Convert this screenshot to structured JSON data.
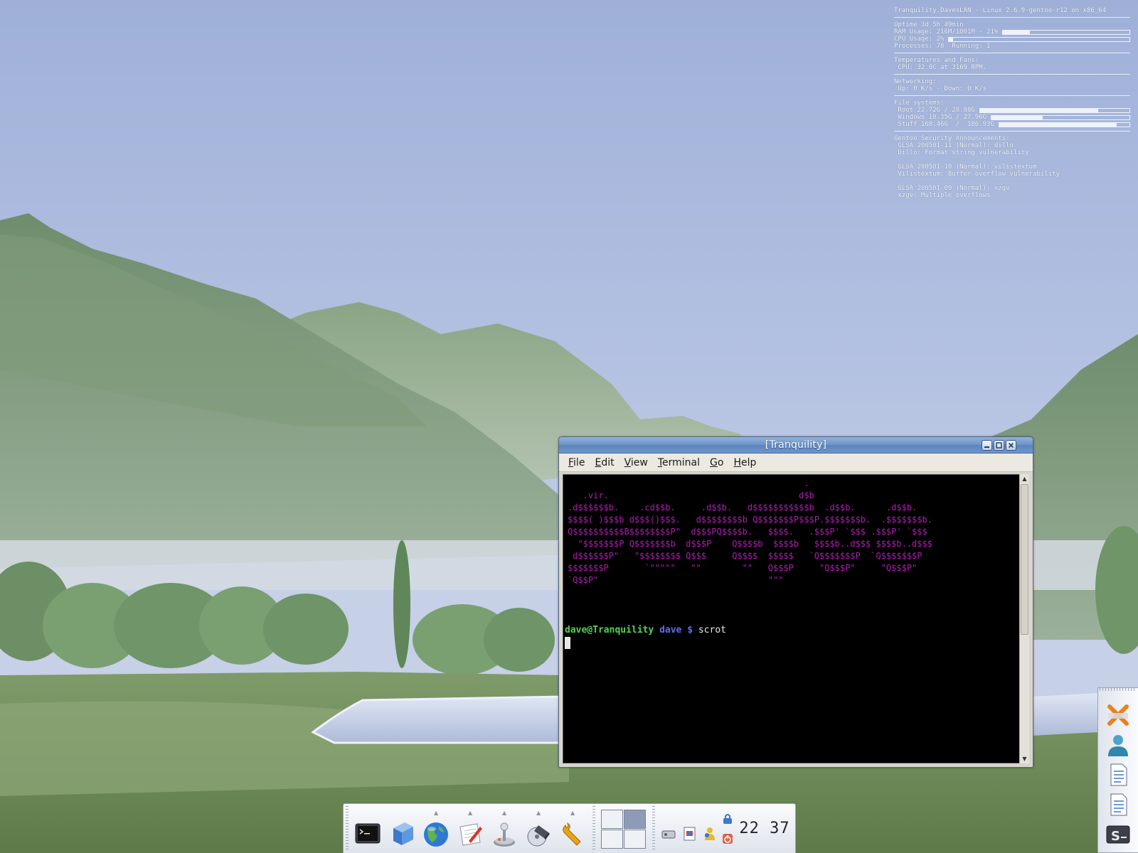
{
  "conky": {
    "header": "Tranquility.DavesLAN - Linux 2.6.9-gentoo-r12 on x86_64",
    "uptime": "Uptime 3d 5h 49min",
    "ram_label": "RAM Usage: 216M/1001M - 21%",
    "ram_fraction": 0.21,
    "cpu_label": "CPU Usage: 2%",
    "cpu_fraction": 0.02,
    "processes": "Processes: 78  Running: 1",
    "temps_title": "Temperatures and Fans:",
    "temps_value": " CPU: 32.0C at 3169 RPM.",
    "net_title": "Networking:",
    "net_value": " Up: 0 K/s - Down: 0 K/s",
    "fs_title": "File systems:",
    "fs": [
      {
        "label": " Root 22.72G / 28.88G",
        "fraction": 0.79
      },
      {
        "label": " Windows 10.35G / 27.96G",
        "fraction": 0.37
      },
      {
        "label": " Stuff 168.46G  /  186.93G",
        "fraction": 0.9
      }
    ],
    "glsa_title": "Gentoo Security Announcements:",
    "glsa": [
      {
        "id": " GLSA 200501-11 (Normal): dillo",
        "desc": " Dillo: Format string vulnerability"
      },
      {
        "id": " GLSA 200501-10 (Normal): vilistextum",
        "desc": " Vilistextum: Buffer overflow vulnerability"
      },
      {
        "id": " GLSA 200501-09 (Normal): xzgv",
        "desc": " xzgv: Multiple overflows"
      }
    ]
  },
  "terminal": {
    "title": "[Tranquility]",
    "menu": [
      "File",
      "Edit",
      "View",
      "Terminal",
      "Go",
      "Help"
    ],
    "menu_mnemonics": [
      "F",
      "E",
      "V",
      "T",
      "G",
      "H"
    ],
    "ascii_lines": [
      "                                              .",
      "   .vir.                                     d$b",
      ".d$$$$$$b.    .cd$$b.     .d$$b.   d$$$$$$$$$$$b  .d$$b.      .d$$b.",
      "$$$$( )$$$b d$$$()$$$.   d$$$$$$$$b Q$$$$$$$P$$$P.$$$$$$$b.  .$$$$$$$b.",
      "Q$$$$$$$$$$B$$$$$$$$P\"  d$$$PQ$$$$b.   $$$$.   .$$$P' `$$$ .$$$P' `$$$",
      "  \"$$$$$$$P Q$$$$$$$b  d$$$P    Q$$$$b  $$$$b   $$$$b..d$$$ $$$$b..d$$$",
      " d$$$$$$P\"   \"$$$$$$$$ Q$$$     Q$$$$  $$$$$   `Q$$$$$$$P  `Q$$$$$$$P",
      "$$$$$$$P       `\"\"\"\"\"   \"\"        \"\"   Q$$$P     \"Q$$$P\"     \"Q$$$P\"",
      "`Q$$P\"                                 \"\"\""
    ],
    "prompt_user": "dave@Tranquility",
    "prompt_dir": "dave $",
    "command": "scrot"
  },
  "panel": {
    "launchers": [
      "terminal-icon",
      "file-manager-icon",
      "web-browser-icon",
      "text-editor-icon",
      "joystick-icon",
      "disk-burner-icon",
      "settings-wrench-icon"
    ],
    "clock": "22 37"
  },
  "dock": {
    "items": [
      "xmms-icon",
      "user-icon",
      "document-icon",
      "document-icon",
      "terminal-s-icon"
    ]
  },
  "colors": {
    "ascii": "#b01ab3",
    "prompt_user": "#52d152",
    "prompt_dir": "#5d6ef0",
    "titlebar": "#6c93c7"
  }
}
